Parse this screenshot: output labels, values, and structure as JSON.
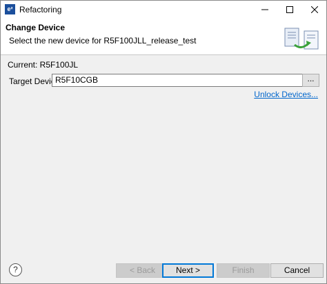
{
  "window": {
    "title": "Refactoring",
    "app_icon_text": "e²"
  },
  "header": {
    "title": "Change Device",
    "description": "Select the new device for R5F100JLL_release_test"
  },
  "content": {
    "current_label": "Current: R5F100JL",
    "target_label": "Target Device:",
    "target_value": "R5F10CGB",
    "browse_label": "...",
    "unlock_label": "Unlock Devices..."
  },
  "footer": {
    "help_label": "?",
    "back_label": "< Back",
    "next_label": "Next >",
    "finish_label": "Finish",
    "cancel_label": "Cancel"
  },
  "colors": {
    "link": "#0066cc",
    "focus_border": "#0078d7"
  }
}
